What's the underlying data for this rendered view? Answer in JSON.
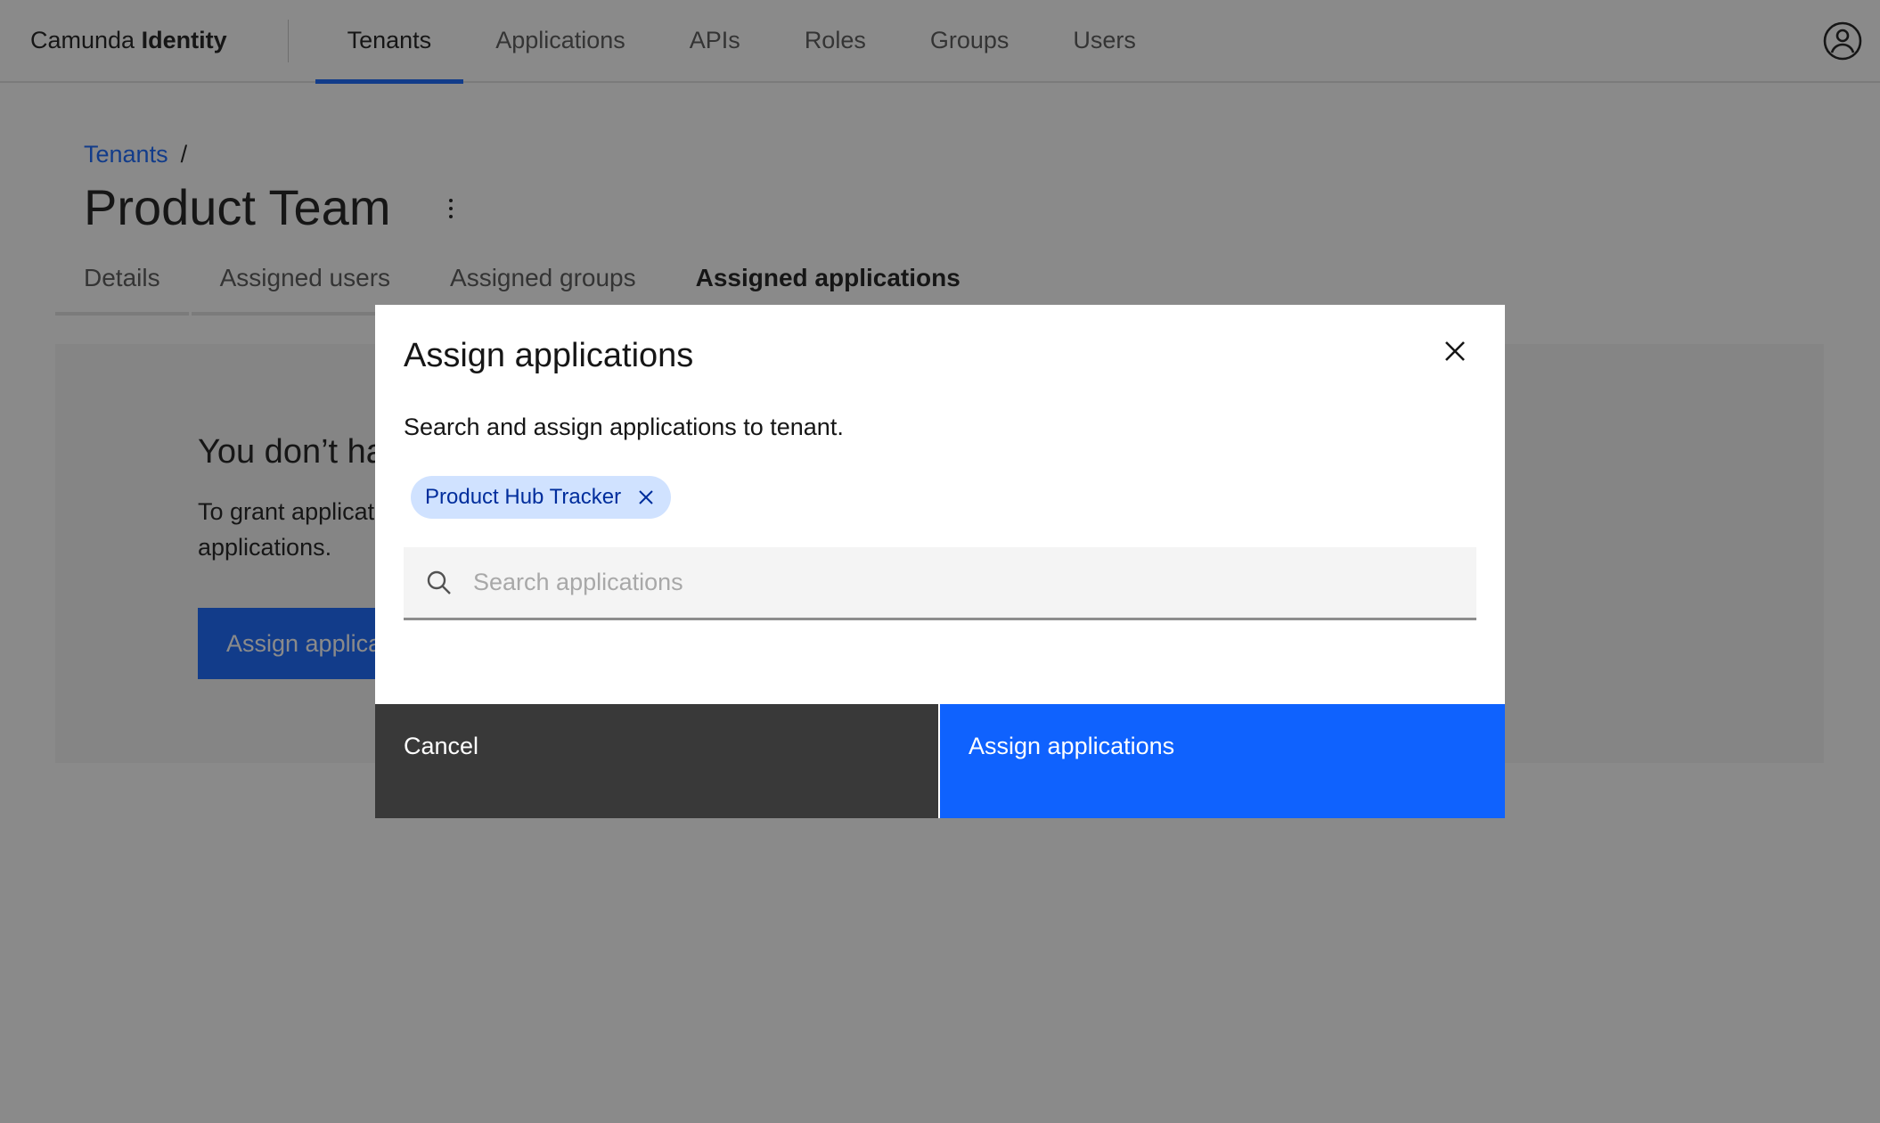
{
  "header": {
    "brand_prefix": "Camunda",
    "brand_bold": "Identity",
    "nav": [
      {
        "label": "Tenants",
        "active": true
      },
      {
        "label": "Applications",
        "active": false
      },
      {
        "label": "APIs",
        "active": false
      },
      {
        "label": "Roles",
        "active": false
      },
      {
        "label": "Groups",
        "active": false
      },
      {
        "label": "Users",
        "active": false
      }
    ],
    "user_icon": "user-avatar-icon"
  },
  "page": {
    "breadcrumb": {
      "link": "Tenants",
      "separator": "/"
    },
    "title": "Product Team",
    "overflow_icon": "overflow-menu-vertical-icon",
    "tabs": [
      {
        "label": "Details",
        "active": false
      },
      {
        "label": "Assigned users",
        "active": false
      },
      {
        "label": "Assigned groups",
        "active": false
      },
      {
        "label": "Assigned applications",
        "active": true
      }
    ],
    "empty_state": {
      "title": "You don’t have any applications assigned",
      "text": "To grant applications access to this tenant, assign applications.",
      "button_label": "Assign applications"
    }
  },
  "modal": {
    "title": "Assign applications",
    "description": "Search and assign applications to tenant.",
    "close_icon": "close-icon",
    "selected_tags": [
      {
        "label": "Product Hub Tracker"
      }
    ],
    "search": {
      "value": "",
      "placeholder": "Search applications",
      "icon": "search-icon"
    },
    "footer": {
      "cancel_label": "Cancel",
      "primary_label": "Assign applications"
    }
  },
  "colors": {
    "primary": "#0f62fe",
    "tag_bg": "#d0e2ff",
    "tag_text": "#002d9c",
    "secondary_button": "#393939",
    "overlay": "rgba(22,22,22,0.5)"
  }
}
